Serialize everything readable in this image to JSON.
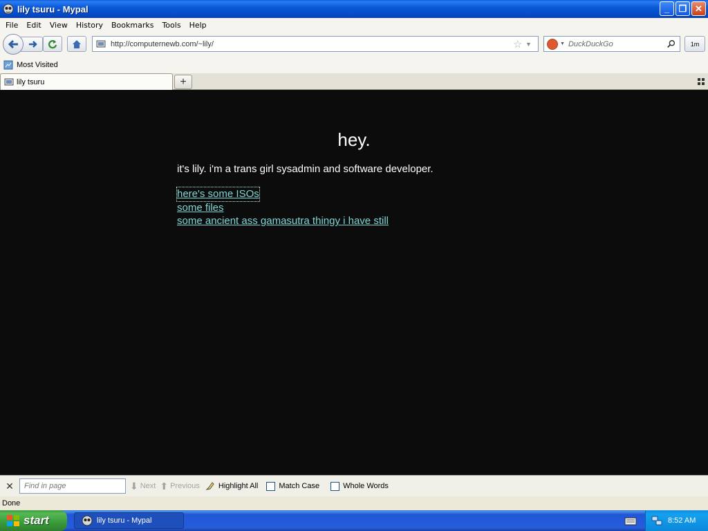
{
  "window": {
    "title": "lily tsuru - Mypal",
    "minimize": "_",
    "restore": "❐",
    "close": "✕"
  },
  "menu": [
    "File",
    "Edit",
    "View",
    "History",
    "Bookmarks",
    "Tools",
    "Help"
  ],
  "nav": {
    "url": "http://computernewb.com/~lily/",
    "search_placeholder": "DuckDuckGo",
    "ext_label": "1m"
  },
  "bookmarks": {
    "items": [
      "Most Visited"
    ]
  },
  "tabs": [
    {
      "label": "lily tsuru"
    }
  ],
  "page": {
    "heading": "hey.",
    "bio": "it's lily. i'm a trans girl sysadmin and software developer.",
    "links": [
      "here's some ISOs",
      "some files",
      "some ancient ass gamasutra thingy i have still"
    ]
  },
  "findbar": {
    "placeholder": "Find in page",
    "next": "Next",
    "previous": "Previous",
    "highlight": "Highlight All",
    "match_case": "Match Case",
    "whole_words": "Whole Words"
  },
  "status": "Done",
  "taskbar": {
    "start": "start",
    "task": "lily tsuru - Mypal",
    "clock": "8:52 AM"
  },
  "colors": {
    "page_bg": "#0c0c0c",
    "link": "#7fd6d6",
    "titlebar": "#0b5ad8",
    "taskbar": "#245ddb",
    "start": "#3a9a3a"
  }
}
